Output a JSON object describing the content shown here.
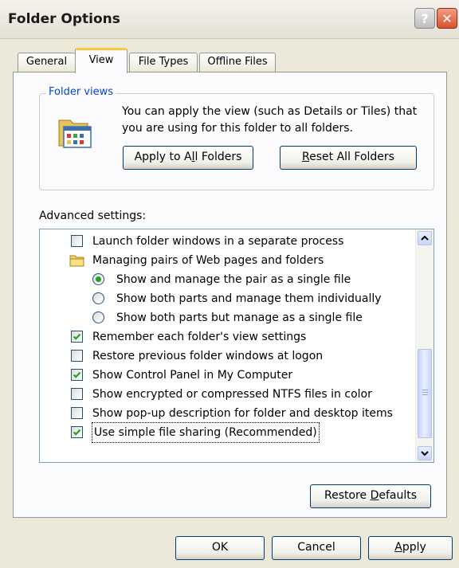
{
  "window": {
    "title": "Folder Options"
  },
  "tabs": [
    "General",
    "View",
    "File Types",
    "Offline Files"
  ],
  "folder_views": {
    "label": "Folder views",
    "description": "You can apply the view (such as Details or Tiles) that you are using for this folder to all folders.",
    "apply_button": {
      "before": "Apply to A",
      "accel": "l",
      "after": "l Folders"
    },
    "reset_button": {
      "before": "",
      "accel": "R",
      "after": "eset All Folders"
    }
  },
  "advanced": {
    "label": "Advanced settings:",
    "items": [
      {
        "type": "checkbox",
        "checked": false,
        "label": "Launch folder windows in a separate process"
      },
      {
        "type": "folder",
        "label": "Managing pairs of Web pages and folders"
      },
      {
        "type": "radio",
        "selected": true,
        "label": "Show and manage the pair as a single file"
      },
      {
        "type": "radio",
        "selected": false,
        "label": "Show both parts and manage them individually"
      },
      {
        "type": "radio",
        "selected": false,
        "label": "Show both parts but manage as a single file"
      },
      {
        "type": "checkbox",
        "checked": true,
        "label": "Remember each folder's view settings"
      },
      {
        "type": "checkbox",
        "checked": false,
        "label": "Restore previous folder windows at logon"
      },
      {
        "type": "checkbox",
        "checked": true,
        "label": "Show Control Panel in My Computer"
      },
      {
        "type": "checkbox",
        "checked": false,
        "label": "Show encrypted or compressed NTFS files in color"
      },
      {
        "type": "checkbox",
        "checked": false,
        "label": "Show pop-up description for folder and desktop items"
      },
      {
        "type": "checkbox",
        "checked": true,
        "label": "Use simple file sharing (Recommended)"
      }
    ]
  },
  "restore_defaults": {
    "before": "Restore ",
    "accel": "D",
    "after": "efaults"
  },
  "footer": {
    "ok": "OK",
    "cancel": "Cancel",
    "apply": {
      "before": "",
      "accel": "A",
      "after": "pply"
    }
  },
  "colors": {
    "accent": "#0046d5",
    "tab_highlight": "#ffc83c",
    "check": "#21a121",
    "close": "#d8532f"
  }
}
